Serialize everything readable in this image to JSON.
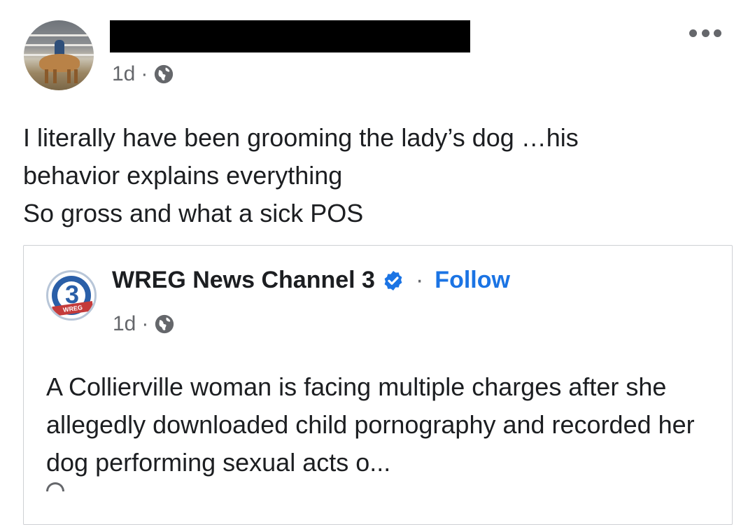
{
  "post": {
    "timestamp": "1d",
    "separator": "·",
    "privacy_icon": "globe-icon",
    "text": "I literally have been grooming the lady’s dog …his\nbehavior explains everything\nSo gross and what a sick POS",
    "more_icon": "more-options-icon"
  },
  "shared_post": {
    "page_name": "WREG News Channel 3",
    "verified_icon": "verified-badge-icon",
    "separator": "·",
    "follow_label": "Follow",
    "logo_text": "WREG",
    "timestamp": "1d",
    "time_separator": "·",
    "privacy_icon": "globe-icon",
    "text": "A Collierville woman is facing multiple charges after she allegedly downloaded child pornography and recorded her dog performing sexual acts o..."
  },
  "colors": {
    "link_blue": "#1b74e4",
    "secondary_text": "#65676b",
    "primary_text": "#1c1e21",
    "border": "#ced0d4"
  }
}
